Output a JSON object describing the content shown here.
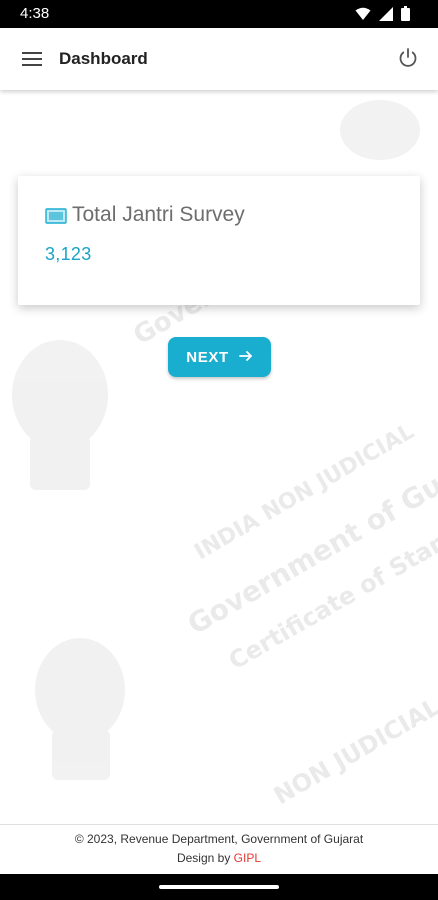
{
  "status_bar": {
    "time": "4:38",
    "icons": [
      "wifi-icon",
      "signal-icon",
      "battery-icon"
    ]
  },
  "app_bar": {
    "title": "Dashboard",
    "menu_icon": "hamburger-menu-icon",
    "power_icon": "power-icon"
  },
  "card": {
    "icon": "survey-card-icon",
    "title": "Total Jantri Survey",
    "value": "3,123"
  },
  "next_button": {
    "label": "NEXT",
    "icon": "arrow-right-icon"
  },
  "footer": {
    "copyright": "© 2023, Revenue Department, Government of Gujarat",
    "design_prefix": "Design by ",
    "design_brand": "GIPL"
  },
  "colors": {
    "accent": "#19aed0",
    "value_text": "#1aa3c6",
    "brand": "#e53935"
  }
}
